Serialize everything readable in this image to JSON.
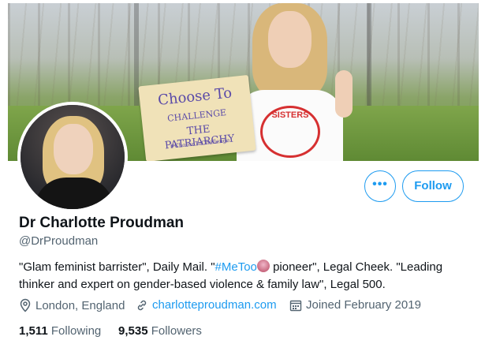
{
  "banner": {
    "sign_line1": "Choose To",
    "sign_line2": "CHALLENGE",
    "sign_line3": "THE PATRIARCHY",
    "sign_line4": "#ChooseToChallenge",
    "shirt_text": "SISTERS"
  },
  "actions": {
    "more_label": "•••",
    "follow_label": "Follow"
  },
  "profile": {
    "name": "Dr Charlotte Proudman",
    "handle": "@DrProudman",
    "bio_part1": "\"Glam feminist barrister\", Daily Mail. \"",
    "bio_hashtag": "#MeToo",
    "bio_part2": " pioneer\", Legal Cheek. \"Leading thinker and expert on gender-based violence & family law\", Legal 500.",
    "location": "London, England",
    "website": "charlotteproudman.com",
    "joined": "Joined February 2019"
  },
  "stats": {
    "following_count": "1,511",
    "following_label": "Following",
    "followers_count": "9,535",
    "followers_label": "Followers"
  },
  "icons": {
    "location": "location-pin-icon",
    "website": "link-icon",
    "joined": "calendar-icon",
    "more": "more-dots-icon"
  },
  "colors": {
    "accent": "#1d9bf0",
    "secondary_text": "#536471",
    "primary_text": "#0f1419"
  }
}
